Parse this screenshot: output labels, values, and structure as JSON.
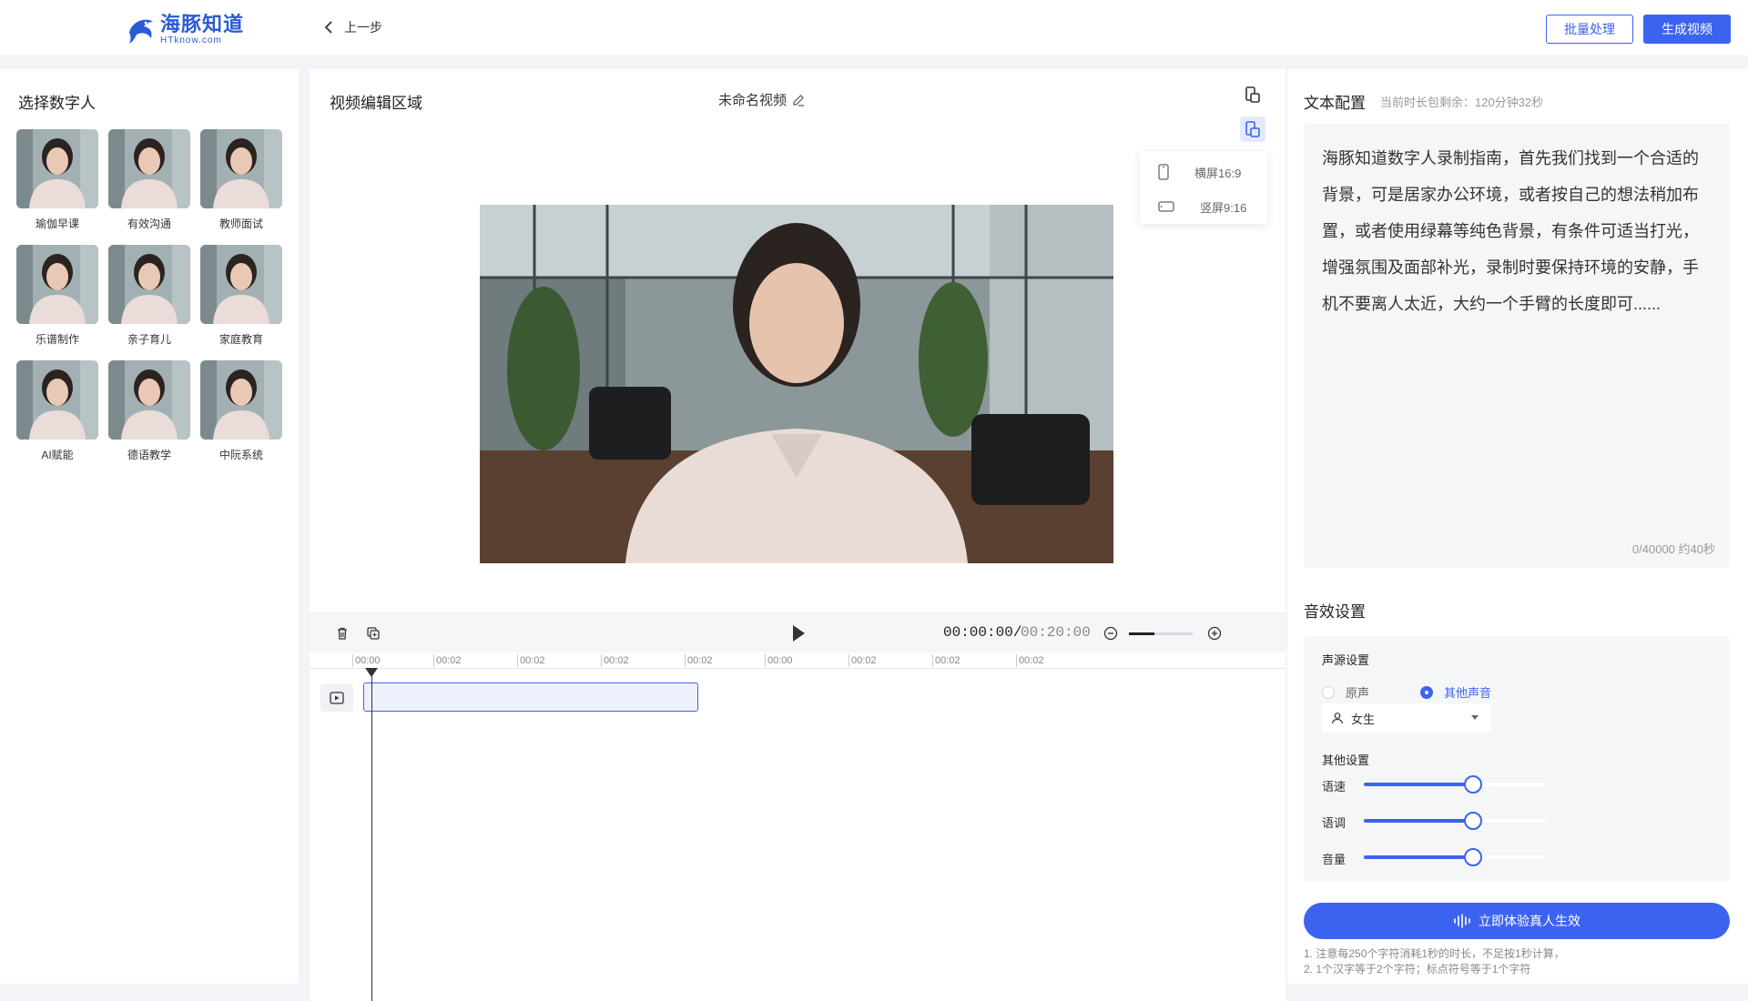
{
  "header": {
    "logo_cn": "海豚知道",
    "logo_en": "HTknow.com",
    "back_label": "上一步",
    "batch_label": "批量处理",
    "generate_label": "生成视频"
  },
  "left": {
    "title": "选择数字人",
    "avatars": [
      {
        "label": "瑜伽早课"
      },
      {
        "label": "有效沟通"
      },
      {
        "label": "教师面试"
      },
      {
        "label": "乐谱制作"
      },
      {
        "label": "亲子育儿"
      },
      {
        "label": "家庭教育"
      },
      {
        "label": "AI赋能"
      },
      {
        "label": "德语教学"
      },
      {
        "label": "中阮系统"
      }
    ]
  },
  "center": {
    "title": "视频编辑区域",
    "video_name": "未命名视频",
    "ratio_options": [
      "横屏16:9",
      "竖屏9:16"
    ],
    "time_current": "00:00:00/",
    "time_total": "00:20:00",
    "ruler_ticks": [
      "00:00",
      "00:02",
      "00:02",
      "00:02",
      "00:02",
      "00:00",
      "00:02",
      "00:02",
      "00:02"
    ],
    "zoom_level": 0.4
  },
  "right": {
    "text_title": "文本配置",
    "remaining": "当前时长包剩余：120分钟32秒",
    "script_text": "海豚知道数字人录制指南，首先我们找到一个合适的背景，可是居家办公环境，或者按自己的想法稍加布置，或者使用绿幕等纯色背景，有条件可适当打光，增强氛围及面部补光，录制时要保持环境的安静，手机不要离人太近，大约一个手臂的长度即可......",
    "char_count": "0/40000 约40秒",
    "audio_title": "音效设置",
    "source_title": "声源设置",
    "source_original": "原声",
    "source_other": "其他声音",
    "voice_selected": "女生",
    "other_title": "其他设置",
    "sliders": [
      {
        "label": "语速",
        "value": 0.6
      },
      {
        "label": "语调",
        "value": 0.6
      },
      {
        "label": "音量",
        "value": 0.6
      }
    ],
    "cta_label": "立即体验真人生效",
    "note1": "1.  注意每250个字符消耗1秒的时长，不足按1秒计算，",
    "note2": "2.  1个汉字等于2个字符；标点符号等于1个字符"
  },
  "colors": {
    "accent": "#3c63f0",
    "brand": "#2a5bd7"
  }
}
